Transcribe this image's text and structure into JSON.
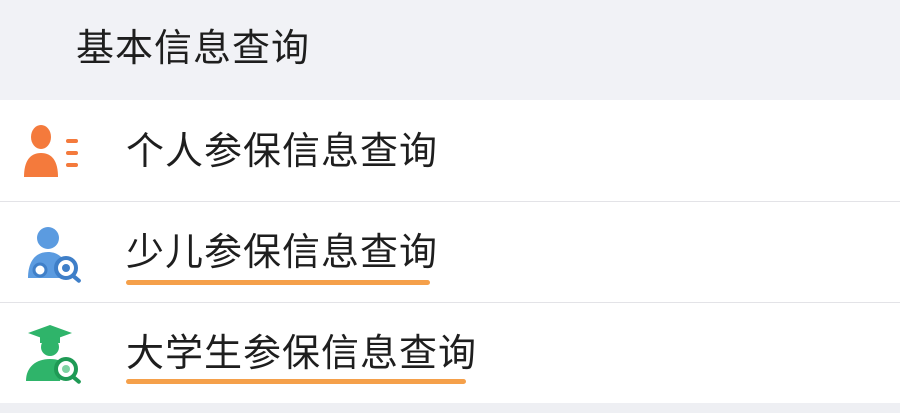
{
  "section": {
    "title": "基本信息查询"
  },
  "items": [
    {
      "label": "个人参保信息查询",
      "icon": "person-list-icon",
      "icon_color": "#f47a3c",
      "underlined": false
    },
    {
      "label": "少儿参保信息查询",
      "icon": "child-search-icon",
      "icon_color": "#4a90d9",
      "underlined": true
    },
    {
      "label": "大学生参保信息查询",
      "icon": "graduate-search-icon",
      "icon_color": "#2fb46a",
      "underlined": true
    }
  ],
  "colors": {
    "underline": "#f5a04a",
    "text": "#1e1e1e",
    "header_bg": "#f1f2f6"
  }
}
